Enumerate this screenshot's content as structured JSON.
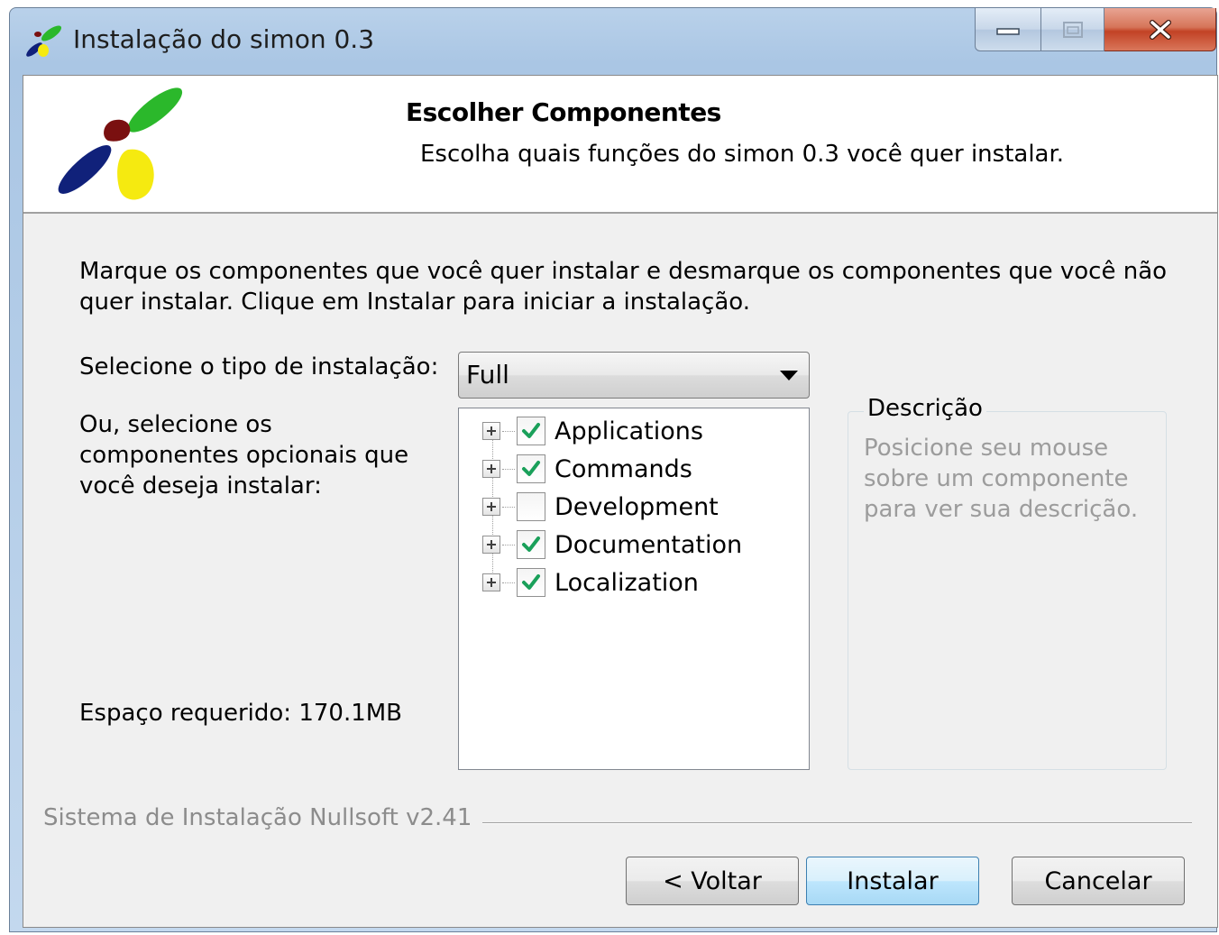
{
  "window": {
    "title": "Instalação do simon 0.3"
  },
  "header": {
    "title": "Escolher Componentes",
    "subtitle": "Escolha quais funções do simon 0.3 você quer instalar."
  },
  "intro": "Marque os componentes que você quer instalar e desmarque os componentes que você não quer instalar. Clique em Instalar para iniciar a instalação.",
  "install_type": {
    "label": "Selecione o tipo de instalação:",
    "selected": "Full"
  },
  "components": {
    "label": "Ou, selecione os componentes opcionais que você deseja instalar:",
    "items": [
      {
        "label": "Applications",
        "checked": true
      },
      {
        "label": "Commands",
        "checked": true
      },
      {
        "label": "Development",
        "checked": false
      },
      {
        "label": "Documentation",
        "checked": true
      },
      {
        "label": "Localization",
        "checked": true
      }
    ]
  },
  "space_required": "Espaço requerido: 170.1MB",
  "description": {
    "legend": "Descrição",
    "text": "Posicione seu mouse sobre um componente para ver sua descrição."
  },
  "branding": "Sistema de Instalação Nullsoft v2.41",
  "buttons": {
    "back": "< Voltar",
    "install": "Instalar",
    "cancel": "Cancelar"
  },
  "colors": {
    "check": "#1aa05a",
    "titlebar": "#b9d1ea",
    "close_button": "#c24225"
  }
}
